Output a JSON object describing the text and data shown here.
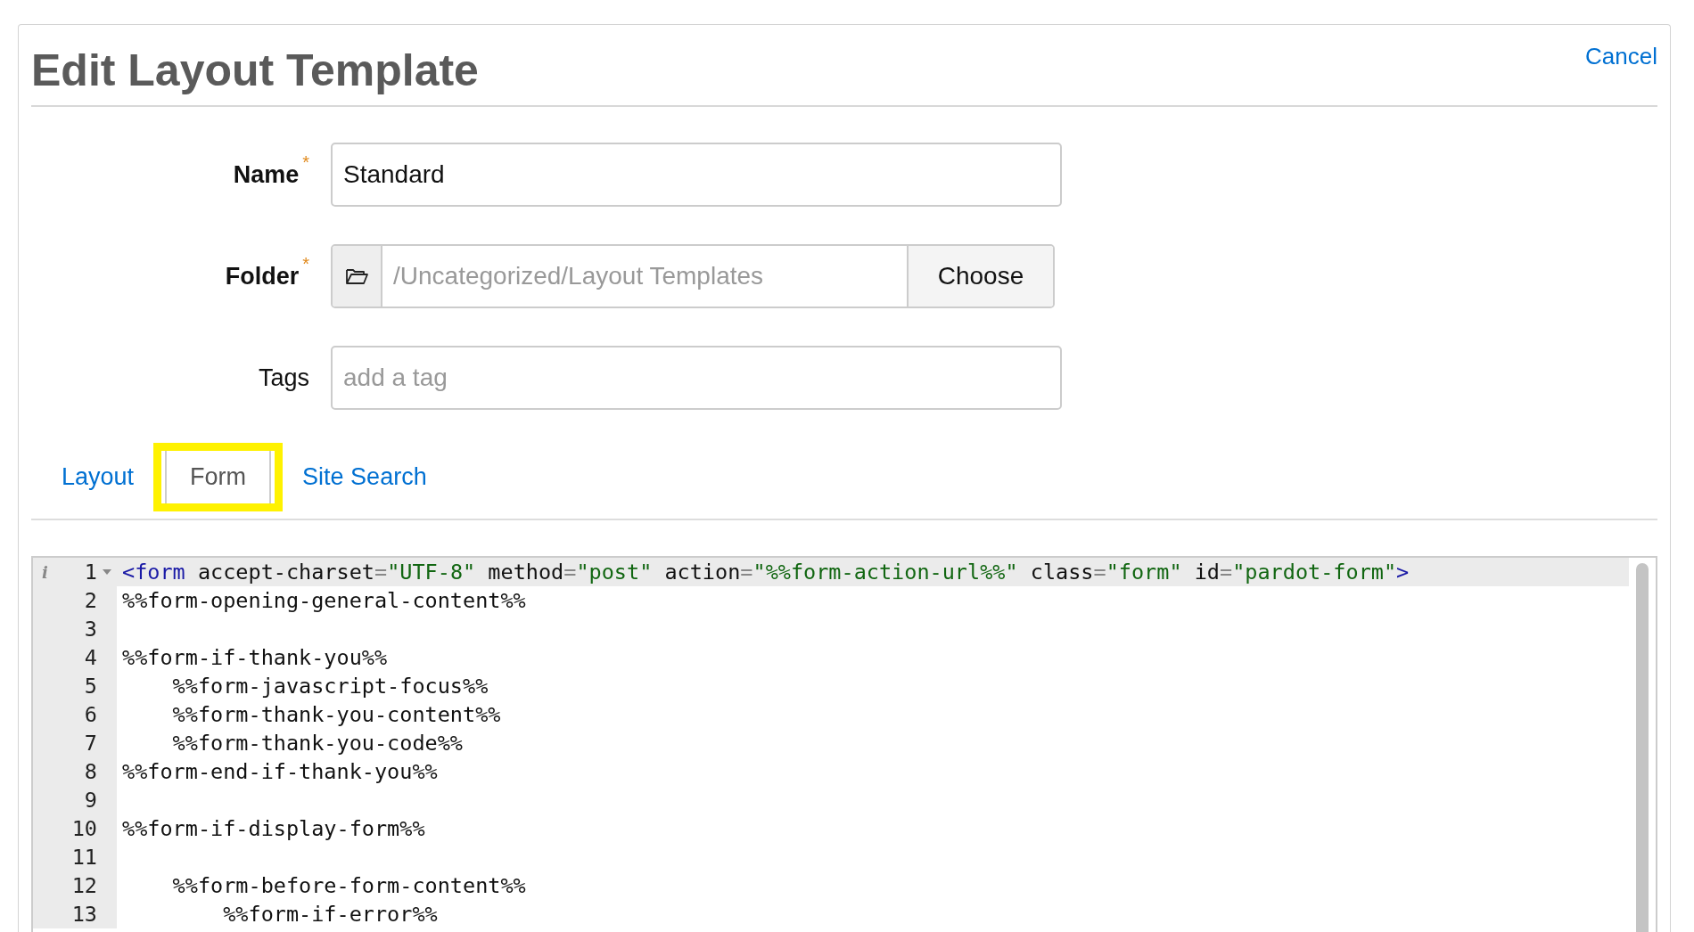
{
  "header": {
    "title": "Edit Layout Template",
    "cancel": "Cancel"
  },
  "fields": [
    {
      "kind": "text",
      "label": "Name",
      "required_mark": "*",
      "value": "Standard"
    },
    {
      "kind": "folder",
      "label": "Folder",
      "required_mark": "*",
      "value": "/Uncategorized/Layout Templates",
      "button": "Choose"
    },
    {
      "kind": "tags",
      "label": "Tags",
      "placeholder": "add a tag"
    }
  ],
  "tabs": [
    {
      "label": "Layout",
      "selected": false,
      "highlighted": false
    },
    {
      "label": "Form",
      "selected": true,
      "highlighted": true
    },
    {
      "label": "Site Search",
      "selected": false,
      "highlighted": false
    }
  ],
  "editor": {
    "lines": [
      {
        "number": "1",
        "marker": "i",
        "foldable": true,
        "active": true,
        "tokens": [
          {
            "kind": "tag",
            "text": "<form"
          },
          {
            "kind": "plain",
            "text": " accept-charset"
          },
          {
            "kind": "eq",
            "text": "="
          },
          {
            "kind": "string",
            "text": "\"UTF-8\""
          },
          {
            "kind": "plain",
            "text": " method"
          },
          {
            "kind": "eq",
            "text": "="
          },
          {
            "kind": "string",
            "text": "\"post\""
          },
          {
            "kind": "plain",
            "text": " action"
          },
          {
            "kind": "eq",
            "text": "="
          },
          {
            "kind": "string",
            "text": "\"%%form-action-url%%\""
          },
          {
            "kind": "plain",
            "text": " class"
          },
          {
            "kind": "eq",
            "text": "="
          },
          {
            "kind": "string",
            "text": "\"form\""
          },
          {
            "kind": "plain",
            "text": " id"
          },
          {
            "kind": "eq",
            "text": "="
          },
          {
            "kind": "string",
            "text": "\"pardot-form\""
          },
          {
            "kind": "tag",
            "text": ">"
          }
        ]
      },
      {
        "number": "2",
        "foldable": false,
        "active": false,
        "tokens": [
          {
            "kind": "plain",
            "text": "%%form-opening-general-content%%"
          }
        ]
      },
      {
        "number": "3",
        "foldable": false,
        "active": false
      },
      {
        "number": "4",
        "foldable": false,
        "active": false,
        "tokens": [
          {
            "kind": "plain",
            "text": "%%form-if-thank-you%%"
          }
        ]
      },
      {
        "number": "5",
        "foldable": false,
        "active": false,
        "tokens": [
          {
            "kind": "plain",
            "text": "    %%form-javascript-focus%%"
          }
        ]
      },
      {
        "number": "6",
        "foldable": false,
        "active": false,
        "tokens": [
          {
            "kind": "plain",
            "text": "    %%form-thank-you-content%%"
          }
        ]
      },
      {
        "number": "7",
        "foldable": false,
        "active": false,
        "tokens": [
          {
            "kind": "plain",
            "text": "    %%form-thank-you-code%%"
          }
        ]
      },
      {
        "number": "8",
        "foldable": false,
        "active": false,
        "tokens": [
          {
            "kind": "plain",
            "text": "%%form-end-if-thank-you%%"
          }
        ]
      },
      {
        "number": "9",
        "foldable": false,
        "active": false
      },
      {
        "number": "10",
        "foldable": false,
        "active": false,
        "tokens": [
          {
            "kind": "plain",
            "text": "%%form-if-display-form%%"
          }
        ]
      },
      {
        "number": "11",
        "foldable": false,
        "active": false
      },
      {
        "number": "12",
        "foldable": false,
        "active": false,
        "tokens": [
          {
            "kind": "plain",
            "text": "    %%form-before-form-content%%"
          }
        ]
      },
      {
        "number": "13",
        "foldable": false,
        "active": false,
        "tokens": [
          {
            "kind": "plain",
            "text": "        %%form-if-error%%"
          }
        ]
      }
    ]
  }
}
